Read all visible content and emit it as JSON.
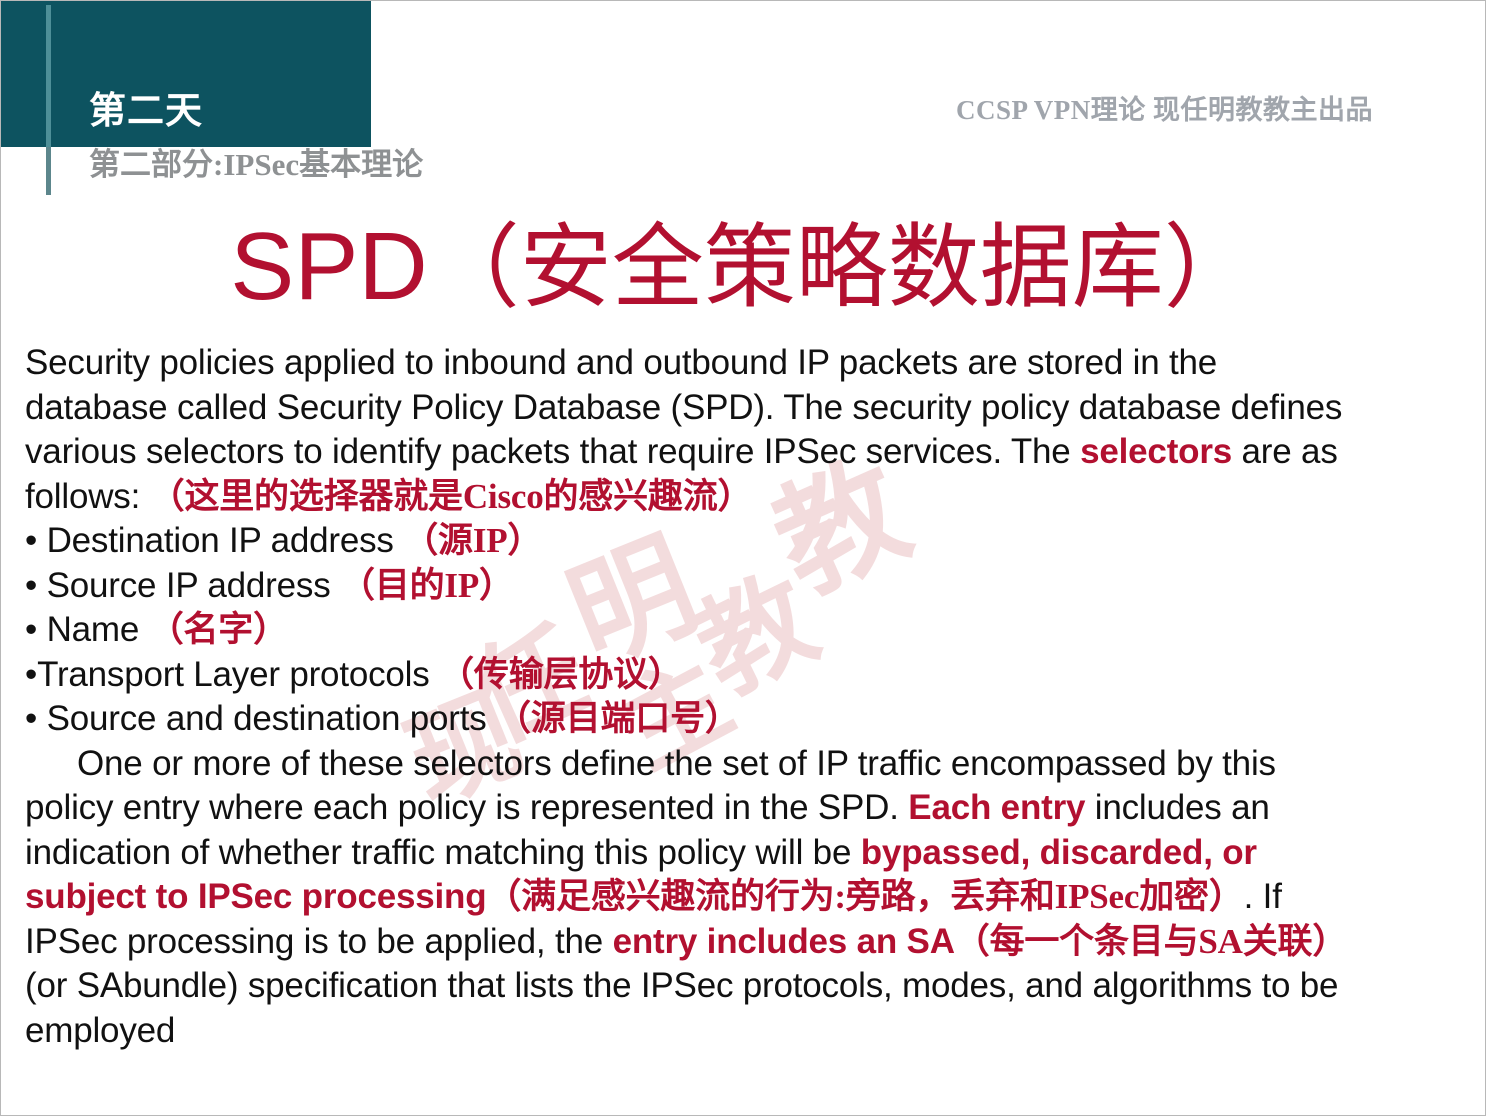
{
  "slide": {
    "header": {
      "day_label": "第二天",
      "part_label": "第二部分:IPSec基本理论",
      "course_tag": "CCSP VPN理论 现任明教教主出品",
      "block_color": "#0d5360",
      "part_color": "#8e9193",
      "tag_color": "#a0a5ac"
    },
    "title": {
      "latin": "SPD",
      "cjk": "（安全策略数据库）",
      "color": "#b21030"
    },
    "watermark": {
      "text": "现任明教教主",
      "chars": [
        "现",
        "任",
        "明",
        "教",
        "教",
        "主"
      ],
      "color": "#d98f92"
    },
    "paragraph1": {
      "line1": "Security policies applied to inbound and outbound IP packets are stored in the",
      "line2": "database called Security Policy Database (SPD). The security policy database defines",
      "line3_a": "various selectors to identify packets that require IPSec services. The ",
      "line3_selectors": "selectors",
      "line3_b": " are as",
      "line4_a": "follows: ",
      "line4_cn": "（这里的选择器就是Cisco的感兴趣流）"
    },
    "bullets": [
      {
        "marker": "•",
        "en": "Destination IP address ",
        "cn": "（源IP）"
      },
      {
        "marker": "•",
        "en": "Source IP address ",
        "cn": "（目的IP）"
      },
      {
        "marker": "•",
        "en": "Name ",
        "cn": "（名字）"
      },
      {
        "marker": "•",
        "en": "Transport Layer protocols ",
        "cn": "（传输层协议）"
      },
      {
        "marker": "•",
        "en": "Source and destination ports ",
        "cn": "（源目端口号）"
      }
    ],
    "paragraph2": {
      "line1": "One or more of these selectors define the set of IP traffic encompassed by this",
      "line2_a": "policy entry where each policy is represented in the SPD. ",
      "line2_bold": "Each entry",
      "line2_b": " includes an",
      "line3_a": "indication of whether traffic matching this policy will be ",
      "line3_bold": "bypassed, discarded, or",
      "line4_bold": "subject to IPSec processing",
      "line4_cn": "（满足感兴趣流的行为:旁路，丢弃和IPSec加密）",
      "line4_b": ". If",
      "line5_a": "IPSec processing is to be applied, the ",
      "line5_bold": "entry includes an SA",
      "line5_cn": "（每一个条目与SA关联）",
      "line6": "(or SAbundle) specification that lists the IPSec protocols, modes, and algorithms to be",
      "line7": "employed"
    }
  }
}
